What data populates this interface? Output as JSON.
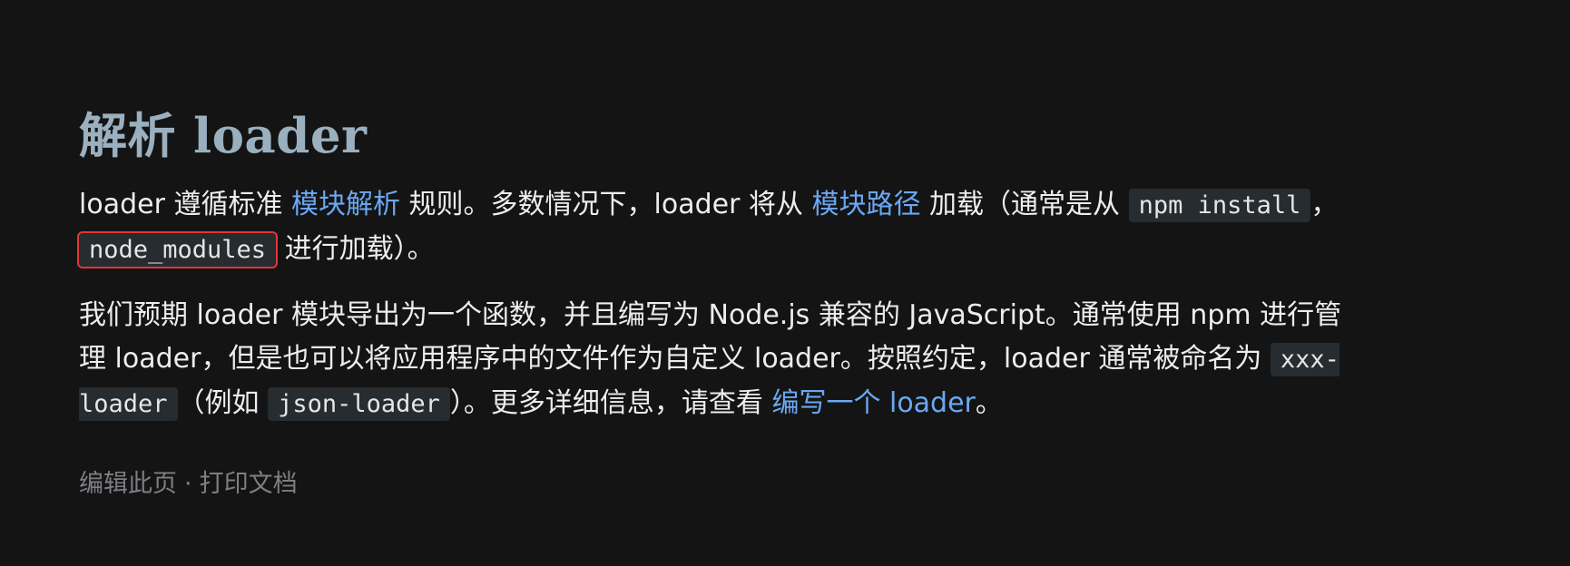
{
  "heading": "解析 loader",
  "para1": {
    "t1": "loader 遵循标准 ",
    "link1": "模块解析",
    "t2": " 规则。多数情况下，loader 将从 ",
    "link2": "模块路径",
    "t3": " 加载（通常是从 ",
    "code1": "npm install",
    "t4": "，",
    "code2": "node_modules",
    "t5": " 进行加载）。"
  },
  "para2": {
    "t1": "我们预期 loader 模块导出为一个函数，并且编写为 Node.js 兼容的 JavaScript。通常使用 npm 进行管理 loader，但是也可以将应用程序中的文件作为自定义 loader。按照约定，loader 通常被命名为 ",
    "code1": "xxx-loader",
    "t2": "（例如 ",
    "code2": "json-loader",
    "t3": "）。更多详细信息，请查看 ",
    "link1": "编写一个 loader",
    "t4": "。"
  },
  "footer": {
    "edit": "编辑此页",
    "separator": "·",
    "print": "打印文档"
  },
  "colors": {
    "background": "#141414",
    "heading": "#9bb0bf",
    "text": "#ecedef",
    "link": "#6aa8f2",
    "code_bg": "#262c30",
    "highlight_border": "#e53638",
    "muted": "#7d7f84"
  }
}
